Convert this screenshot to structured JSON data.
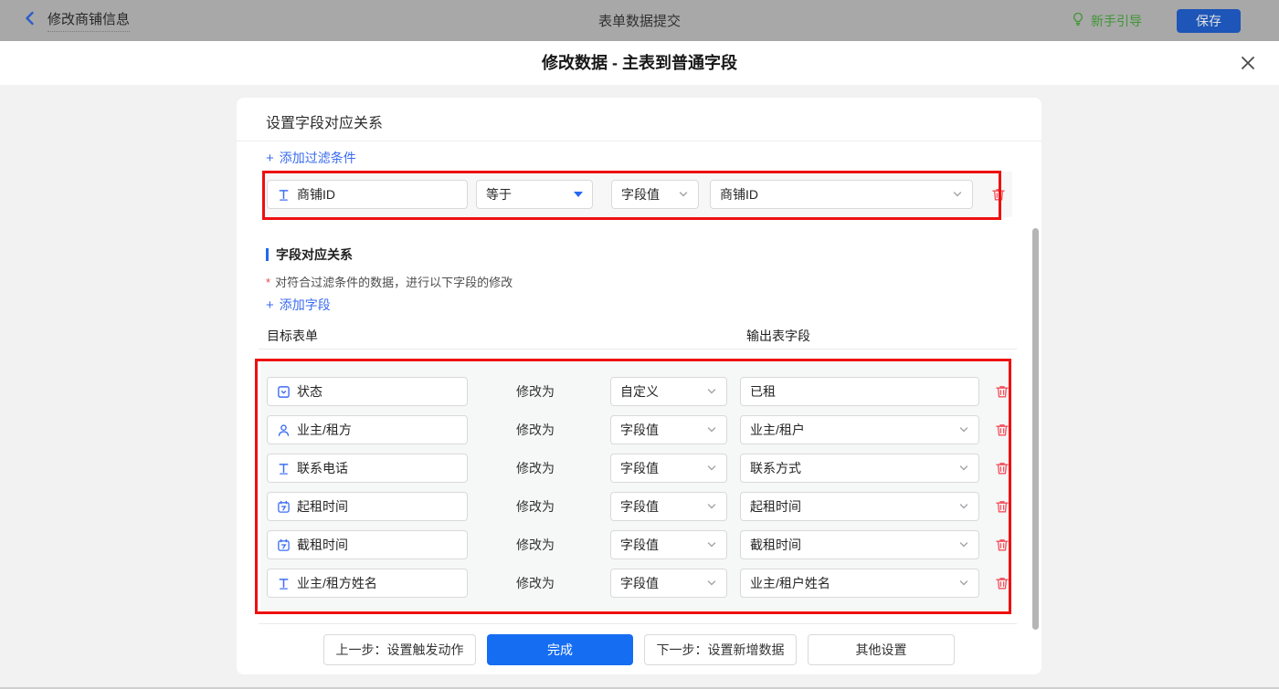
{
  "topbar": {
    "back_label": "修改商铺信息",
    "center_title": "表单数据提交",
    "guide_label": "新手引导",
    "save_label": "保存"
  },
  "dialog": {
    "title": "修改数据 - 主表到普通字段"
  },
  "panel": {
    "header_title": "设置字段对应关系",
    "plus": "+",
    "add_filter_label": "添加过滤条件",
    "filter": {
      "field": "商铺ID",
      "operator": "等于",
      "value_type": "字段值",
      "value": "商铺ID"
    },
    "section_title": "字段对应关系",
    "required_mark": "*",
    "section_desc": "对符合过滤条件的数据，进行以下字段的修改",
    "add_field_label": "添加字段",
    "columns": {
      "target": "目标表单",
      "output": "输出表字段"
    },
    "rows": [
      {
        "target": "状态",
        "modify_label": "修改为",
        "method": "自定义",
        "output": "已租"
      },
      {
        "target": "业主/租方",
        "modify_label": "修改为",
        "method": "字段值",
        "output": "业主/租户"
      },
      {
        "target": "联系电话",
        "modify_label": "修改为",
        "method": "字段值",
        "output": "联系方式"
      },
      {
        "target": "起租时间",
        "modify_label": "修改为",
        "method": "字段值",
        "output": "起租时间"
      },
      {
        "target": "截租时间",
        "modify_label": "修改为",
        "method": "字段值",
        "output": "截租时间"
      },
      {
        "target": "业主/租方姓名",
        "modify_label": "修改为",
        "method": "字段值",
        "output": "业主/租户姓名"
      }
    ],
    "footer": {
      "prev": "上一步：设置触发动作",
      "done": "完成",
      "next": "下一步：设置新增数据",
      "other": "其他设置"
    }
  },
  "colors": {
    "topbar_dimmed_gray": "#a8a8a8",
    "link_blue": "#3a6bef",
    "accent_blue": "#2468f2",
    "primary_button_blue": "#156df2",
    "save_button_blue": "#1d55b8",
    "guide_green": "#3f9535",
    "danger_red": "#f2515c",
    "annotation_red": "#ee1010",
    "row_area_gray": "#f6f7f7"
  }
}
